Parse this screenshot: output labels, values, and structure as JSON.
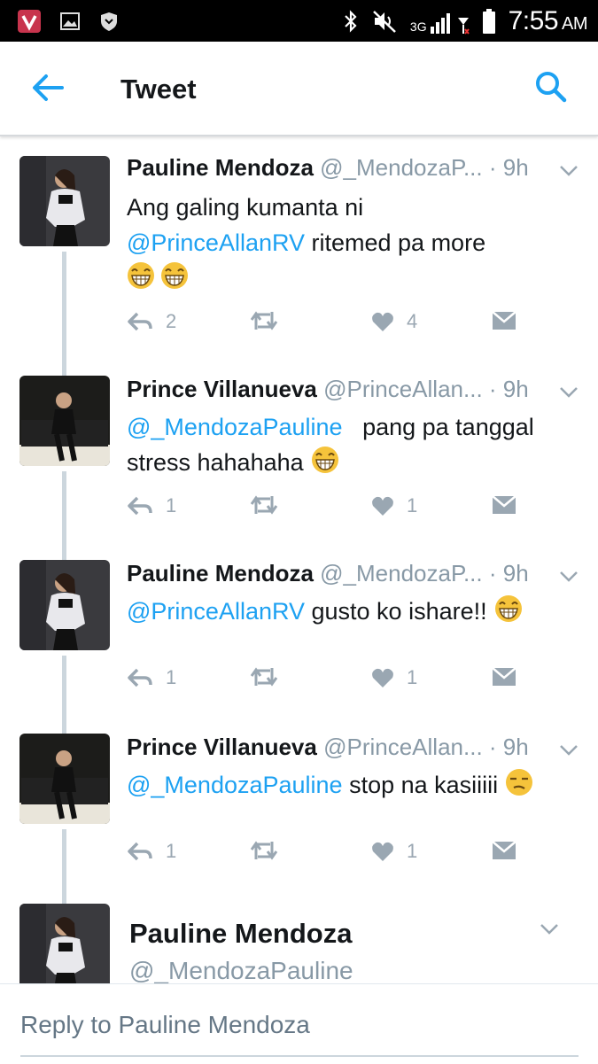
{
  "status_bar": {
    "time": "7:55",
    "ampm": "AM",
    "network": "3G",
    "icons": [
      "app-v-icon",
      "gallery-icon",
      "shield-icon",
      "bluetooth-icon",
      "mute-icon",
      "signal-icon",
      "battery-icon"
    ]
  },
  "header": {
    "title": "Tweet",
    "back_icon": "back-arrow-icon",
    "search_icon": "search-icon"
  },
  "tweets": [
    {
      "name": "Pauline Mendoza",
      "handle": "@_MendozaP...",
      "time": "· 9h",
      "text_plain_1": "Ang galing kumanta ni",
      "mention": "@PrinceAllanRV",
      "text_after": " ritemed pa more",
      "emoji": [
        "grin-emoji",
        "grin-emoji"
      ],
      "replies": "2",
      "retweets": "",
      "likes": "4"
    },
    {
      "name": "Prince Villanueva",
      "handle": "@PrinceAllan...",
      "time": "· 9h",
      "mention": "@_MendozaPauline",
      "text_after": "   pang pa tanggal",
      "text_line2": "stress hahahaha",
      "emoji": [
        "grin-emoji"
      ],
      "replies": "1",
      "retweets": "",
      "likes": "1"
    },
    {
      "name": "Pauline Mendoza",
      "handle": "@_MendozaP...",
      "time": "· 9h",
      "mention": "@PrinceAllanRV",
      "text_after": " gusto ko ishare!!",
      "emoji": [
        "grin-emoji"
      ],
      "replies": "1",
      "retweets": "",
      "likes": "1"
    },
    {
      "name": "Prince Villanueva",
      "handle": "@PrinceAllan...",
      "time": "· 9h",
      "mention": "@_MendozaPauline",
      "text_after": " stop na kasiiiii",
      "emoji": [
        "unamused-emoji"
      ],
      "replies": "1",
      "retweets": "",
      "likes": "1"
    }
  ],
  "focused_tweet": {
    "name": "Pauline Mendoza",
    "handle": "@_MendozaPauline"
  },
  "reply": {
    "placeholder": "Reply to Pauline Mendoza"
  },
  "colors": {
    "link": "#1da1f2",
    "icon": "#9aa7b2",
    "thread": "#ccd6dd"
  }
}
